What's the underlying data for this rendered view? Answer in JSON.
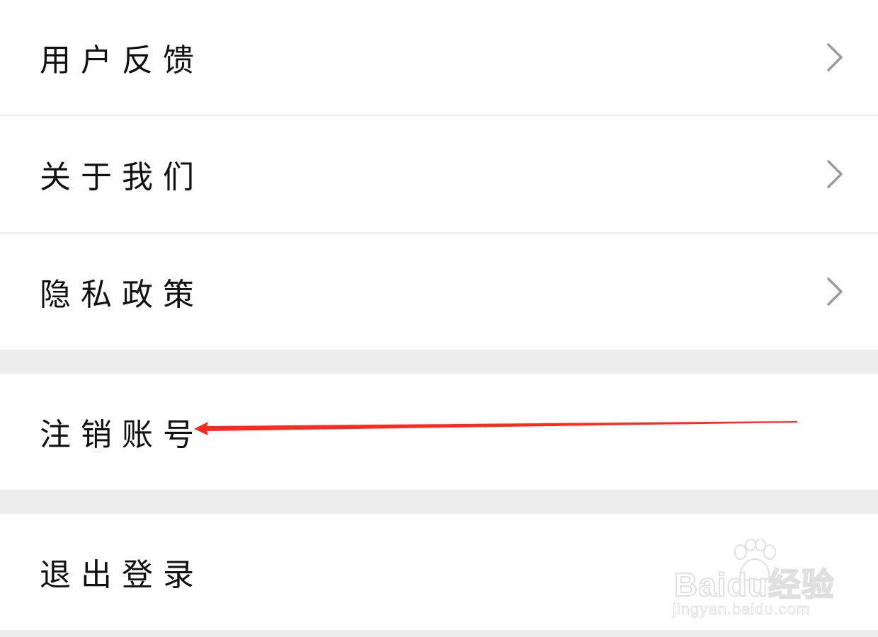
{
  "menu": {
    "group_1": [
      {
        "label": "用户反馈",
        "has_chevron": true
      },
      {
        "label": "关于我们",
        "has_chevron": true
      },
      {
        "label": "隐私政策",
        "has_chevron": true
      }
    ],
    "group_2": [
      {
        "label": "注销账号",
        "has_chevron": false
      }
    ],
    "group_3": [
      {
        "label": "退出登录",
        "has_chevron": false
      }
    ]
  },
  "annotation": {
    "type": "arrow",
    "color": "#ff2a1f",
    "points_to": "注销账号"
  },
  "watermark": {
    "brand": "Bai",
    "brand_suffix": "du",
    "product": "经验",
    "url": "jingyan.baidu.com"
  },
  "colors": {
    "background": "#ededed",
    "row_background": "#ffffff",
    "text": "#111111",
    "chevron": "#9a9a9a",
    "arrow": "#ff2a1f"
  }
}
